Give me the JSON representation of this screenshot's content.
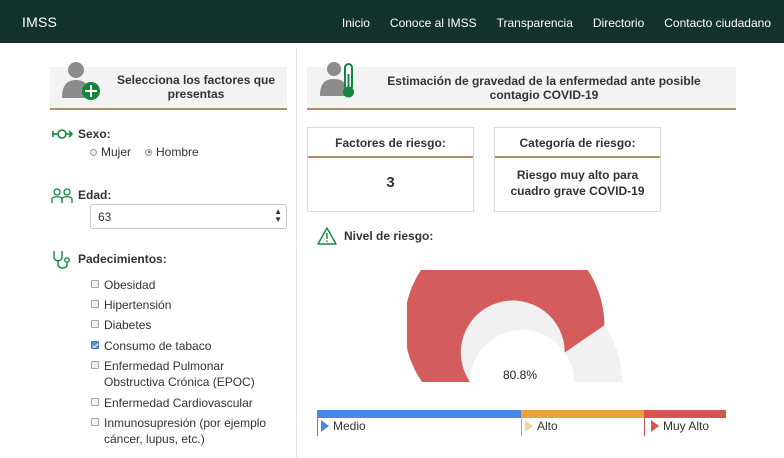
{
  "navbar": {
    "brand": "IMSS",
    "links": [
      "Inicio",
      "Conoce al IMSS",
      "Transparencia",
      "Directorio",
      "Contacto ciudadano"
    ]
  },
  "left": {
    "header": "Selecciona los factores que presentas",
    "sex": {
      "label": "Sexo:",
      "options": [
        "Mujer",
        "Hombre"
      ],
      "selected": "Hombre"
    },
    "age": {
      "label": "Edad:",
      "value": "63"
    },
    "conditions": {
      "label": "Padecimientos:",
      "items": [
        {
          "label": "Obesidad",
          "checked": false
        },
        {
          "label": "Hipertensión",
          "checked": false
        },
        {
          "label": "Diabetes",
          "checked": false
        },
        {
          "label": "Consumo de tabaco",
          "checked": true
        },
        {
          "label": "Enfermedad Pulmonar Obstructiva Crónica (EPOC)",
          "checked": false
        },
        {
          "label": "Enfermedad Cardiovascular",
          "checked": false
        },
        {
          "label": "Inmunosupresión (por ejemplo cáncer, lupus, etc.)",
          "checked": false
        }
      ]
    }
  },
  "right": {
    "header": "Estimación de gravedad de la enfermedad ante posible contagio COVID-19",
    "factors_card": {
      "title": "Factores de riesgo:",
      "value": "3"
    },
    "category_card": {
      "title": "Categoría de riesgo:",
      "value": "Riesgo muy alto para cuadro grave COVID-19"
    },
    "risk_level_label": "Nivel de riesgo:",
    "gauge": {
      "value": 80.8,
      "display": "80.8%",
      "fill_color": "#d45c5c",
      "track_color": "#f1f1f1"
    },
    "legend": [
      {
        "label": "Medio",
        "color": "#4a86e8"
      },
      {
        "label": "Alto",
        "color": "#e6a23c"
      },
      {
        "label": "Muy Alto",
        "color": "#d9534f"
      }
    ]
  },
  "colors": {
    "navbar": "#13322b",
    "accent": "#b38e5d",
    "icon_green": "#10893e"
  }
}
